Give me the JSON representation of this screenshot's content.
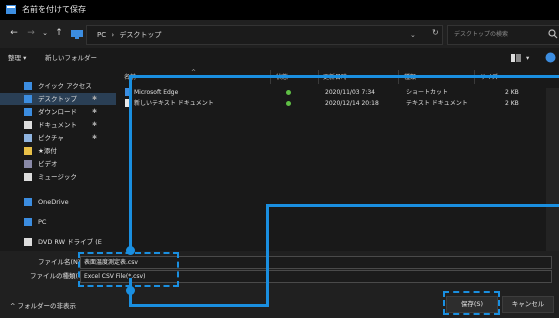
{
  "window": {
    "title": "名前を付けて保存"
  },
  "nav": {
    "back": "←",
    "forward": "→",
    "dropdown": "⌄",
    "up": "↑",
    "breadcrumb": [
      "PC",
      "›",
      "デスクトップ"
    ],
    "addr_dropdown": "⌄",
    "refresh": "↻",
    "search_placeholder": "デスクトップの検索"
  },
  "toolbar": {
    "organize": "整理 ▾",
    "new_folder": "新しいフォルダー"
  },
  "sidebar": {
    "items": [
      {
        "label": "クイック アクセス",
        "pinned": false,
        "icon": "star-icon",
        "color": "#3c8de0"
      },
      {
        "label": "デスクトップ",
        "pinned": true,
        "icon": "desktop-icon",
        "color": "#3c8de0",
        "selected": true
      },
      {
        "label": "ダウンロード",
        "pinned": true,
        "icon": "download-icon",
        "color": "#3c8de0"
      },
      {
        "label": "ドキュメント",
        "pinned": true,
        "icon": "document-icon",
        "color": "#dddddd"
      },
      {
        "label": "ピクチャ",
        "pinned": true,
        "icon": "picture-icon",
        "color": "#8fb4e0"
      },
      {
        "label": "★添付",
        "pinned": false,
        "icon": "folder-icon",
        "color": "#e8c048"
      },
      {
        "label": "ビデオ",
        "pinned": false,
        "icon": "video-icon",
        "color": "#8a8aa8"
      },
      {
        "label": "ミュージック",
        "pinned": false,
        "icon": "music-icon",
        "color": "#dddddd"
      },
      {
        "label": "OneDrive",
        "pinned": false,
        "icon": "cloud-icon",
        "color": "#3c8de0"
      },
      {
        "label": "PC",
        "pinned": false,
        "icon": "pc-icon",
        "color": "#3c8de0"
      },
      {
        "label": "DVD RW ドライブ (E",
        "pinned": false,
        "icon": "dvd-icon",
        "color": "#dddddd"
      }
    ],
    "pin_glyph": "✱"
  },
  "list": {
    "columns": [
      "名前",
      "状態",
      "更新日時",
      "種類",
      "サイズ"
    ],
    "rows": [
      {
        "name": "Microsoft Edge",
        "date": "2020/11/03 7:34",
        "type": "ショートカット",
        "size": "2 KB"
      },
      {
        "name": "新しいテキスト ドキュメント",
        "date": "2020/12/14 20:18",
        "type": "テキスト ドキュメント",
        "size": "2 KB"
      }
    ]
  },
  "form": {
    "filename_label": "ファイル名(N):",
    "filename_value": "表面温度測定表.csv",
    "filetype_label": "ファイルの種類(T):",
    "filetype_value": "Excel CSV File(*.csv)",
    "hide_folders": "^ フォルダーの非表示",
    "save": "保存(S)",
    "cancel": "キャンセル"
  },
  "colors": {
    "highlight": "#1a8fe0",
    "accent": "#3c8de0"
  }
}
